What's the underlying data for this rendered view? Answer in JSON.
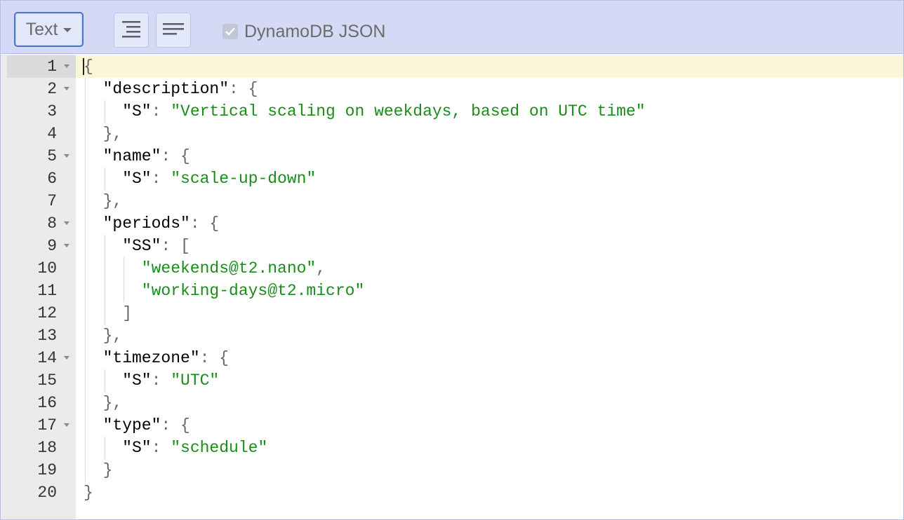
{
  "toolbar": {
    "mode_label": "Text",
    "format_icon": "format-lines-icon",
    "compact_icon": "compact-lines-icon",
    "dynamodb_checked": true,
    "dynamodb_label": "DynamoDB JSON"
  },
  "editor": {
    "lines": [
      {
        "n": "1",
        "fold": true,
        "indent": 0,
        "tokens": [
          {
            "t": "{",
            "c": "punc"
          }
        ]
      },
      {
        "n": "2",
        "fold": true,
        "indent": 1,
        "tokens": [
          {
            "t": "\"description\"",
            "c": "key"
          },
          {
            "t": ": {",
            "c": "punc"
          }
        ]
      },
      {
        "n": "3",
        "fold": false,
        "indent": 2,
        "tokens": [
          {
            "t": "\"S\"",
            "c": "key"
          },
          {
            "t": ": ",
            "c": "punc"
          },
          {
            "t": "\"Vertical scaling on weekdays, based on UTC time\"",
            "c": "str"
          }
        ]
      },
      {
        "n": "4",
        "fold": false,
        "indent": 1,
        "tokens": [
          {
            "t": "},",
            "c": "punc"
          }
        ]
      },
      {
        "n": "5",
        "fold": true,
        "indent": 1,
        "tokens": [
          {
            "t": "\"name\"",
            "c": "key"
          },
          {
            "t": ": {",
            "c": "punc"
          }
        ]
      },
      {
        "n": "6",
        "fold": false,
        "indent": 2,
        "tokens": [
          {
            "t": "\"S\"",
            "c": "key"
          },
          {
            "t": ": ",
            "c": "punc"
          },
          {
            "t": "\"scale-up-down\"",
            "c": "str"
          }
        ]
      },
      {
        "n": "7",
        "fold": false,
        "indent": 1,
        "tokens": [
          {
            "t": "},",
            "c": "punc"
          }
        ]
      },
      {
        "n": "8",
        "fold": true,
        "indent": 1,
        "tokens": [
          {
            "t": "\"periods\"",
            "c": "key"
          },
          {
            "t": ": {",
            "c": "punc"
          }
        ]
      },
      {
        "n": "9",
        "fold": true,
        "indent": 2,
        "tokens": [
          {
            "t": "\"SS\"",
            "c": "key"
          },
          {
            "t": ": [",
            "c": "punc"
          }
        ]
      },
      {
        "n": "10",
        "fold": false,
        "indent": 3,
        "tokens": [
          {
            "t": "\"weekends@t2.nano\"",
            "c": "str"
          },
          {
            "t": ",",
            "c": "punc"
          }
        ]
      },
      {
        "n": "11",
        "fold": false,
        "indent": 3,
        "tokens": [
          {
            "t": "\"working-days@t2.micro\"",
            "c": "str"
          }
        ]
      },
      {
        "n": "12",
        "fold": false,
        "indent": 2,
        "tokens": [
          {
            "t": "]",
            "c": "punc"
          }
        ]
      },
      {
        "n": "13",
        "fold": false,
        "indent": 1,
        "tokens": [
          {
            "t": "},",
            "c": "punc"
          }
        ]
      },
      {
        "n": "14",
        "fold": true,
        "indent": 1,
        "tokens": [
          {
            "t": "\"timezone\"",
            "c": "key"
          },
          {
            "t": ": {",
            "c": "punc"
          }
        ]
      },
      {
        "n": "15",
        "fold": false,
        "indent": 2,
        "tokens": [
          {
            "t": "\"S\"",
            "c": "key"
          },
          {
            "t": ": ",
            "c": "punc"
          },
          {
            "t": "\"UTC\"",
            "c": "str"
          }
        ]
      },
      {
        "n": "16",
        "fold": false,
        "indent": 1,
        "tokens": [
          {
            "t": "},",
            "c": "punc"
          }
        ]
      },
      {
        "n": "17",
        "fold": true,
        "indent": 1,
        "tokens": [
          {
            "t": "\"type\"",
            "c": "key"
          },
          {
            "t": ": {",
            "c": "punc"
          }
        ]
      },
      {
        "n": "18",
        "fold": false,
        "indent": 2,
        "tokens": [
          {
            "t": "\"S\"",
            "c": "key"
          },
          {
            "t": ": ",
            "c": "punc"
          },
          {
            "t": "\"schedule\"",
            "c": "str"
          }
        ]
      },
      {
        "n": "19",
        "fold": false,
        "indent": 1,
        "tokens": [
          {
            "t": "}",
            "c": "punc"
          }
        ]
      },
      {
        "n": "20",
        "fold": false,
        "indent": 0,
        "tokens": [
          {
            "t": "}",
            "c": "punc"
          }
        ]
      }
    ]
  }
}
